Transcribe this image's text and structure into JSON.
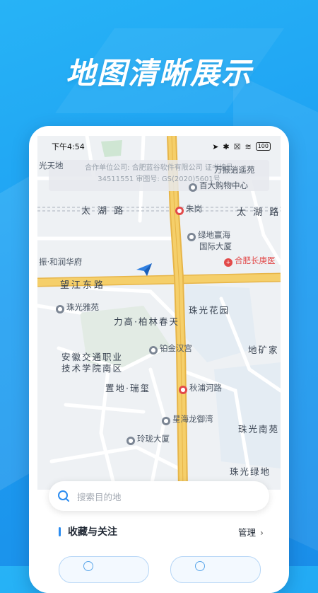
{
  "headline": "地图清晰展示",
  "status_bar": {
    "time": "下午4:54",
    "battery": "100"
  },
  "watermark": {
    "line1": "合作单位公司: 合肥蓝谷软件有限公司  证书编号",
    "line2": "34511551  审图号: GS(2020)5601号"
  },
  "map": {
    "roads": {
      "taihu_left": "太 湖 路",
      "taihu_right": "太 湖 路",
      "wangjiang": "望江东路",
      "qiupu": "秋浦河路"
    },
    "places": {
      "guangtiandi": "光天地",
      "wanzhen": "万振逍遥苑",
      "baida": "百大购物中心",
      "zhugang": "朱岗",
      "lvdi": "绿地赢海",
      "lvdi2": "国际大厦",
      "hefei_hospital": "合肥长庚医",
      "zhenhe": "振·和润华府",
      "zhuguang_yayuan": "珠光雅苑",
      "zhuguang_huayuan": "珠光花园",
      "ligao": "力高·柏林春天",
      "bojin": "铂金汉宫",
      "dikuangjia": "地矿家",
      "anhui1": "安徽交通职业",
      "anhui2": "技术学院南区",
      "zhidi": "置地·瑞玺",
      "xinghai": "星海龙御湾",
      "zhuguang_nanyuan": "珠光南苑",
      "linglong": "玲珑大厦",
      "zhuguang_lvdi": "珠光绿地"
    }
  },
  "search": {
    "placeholder": "搜索目的地"
  },
  "favorites": {
    "title": "收藏与关注",
    "manage": "管理"
  },
  "colors": {
    "accent": "#2b8cf0",
    "background": "#1d9ff2",
    "main_road": "#f2c14e"
  }
}
